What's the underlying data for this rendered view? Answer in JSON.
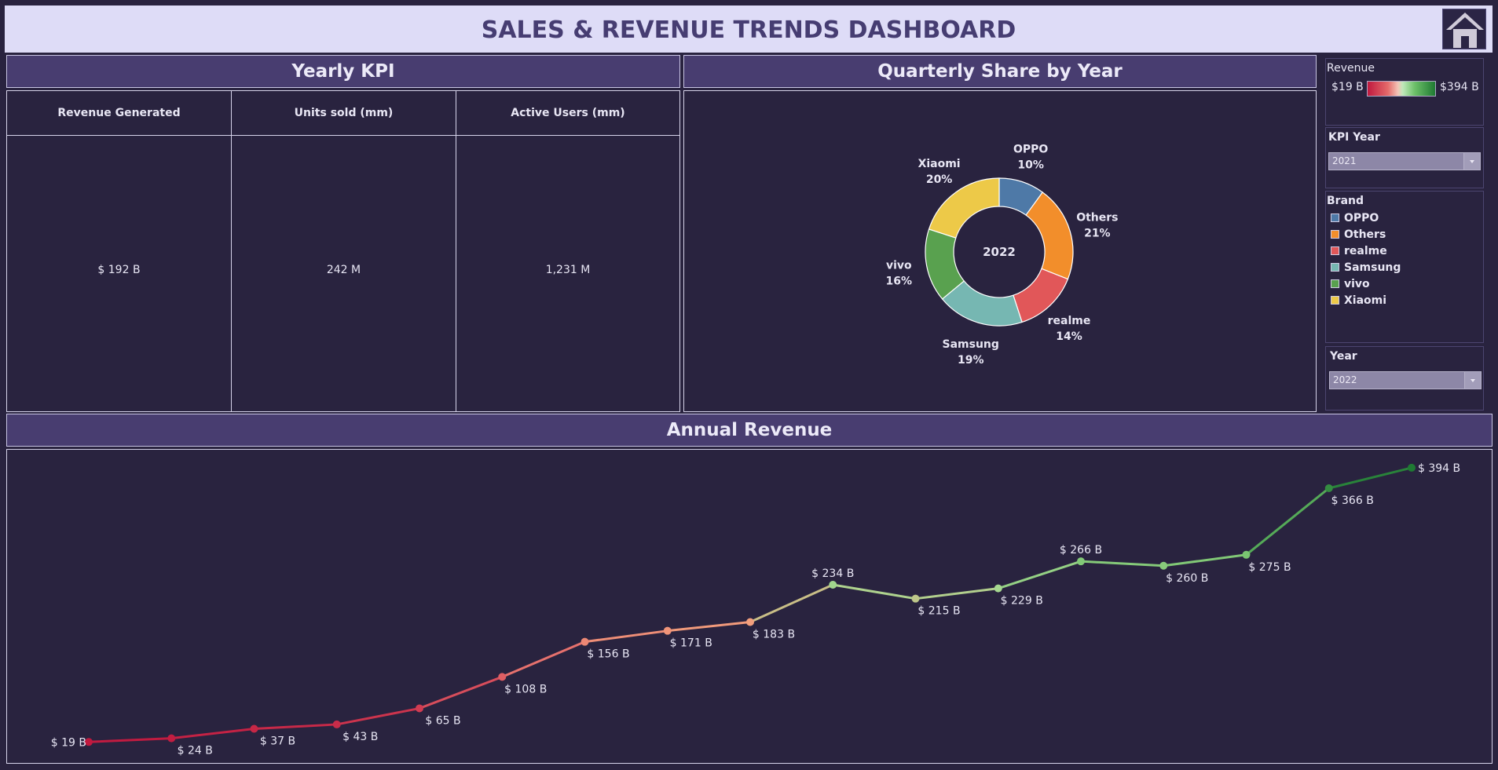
{
  "header": {
    "title": "SALES & REVENUE TRENDS DASHBOARD"
  },
  "kpi": {
    "section_title": "Yearly KPI",
    "columns": [
      {
        "label": "Revenue Generated",
        "value": "$ 192 B"
      },
      {
        "label": "Units sold (mm)",
        "value": "242 M"
      },
      {
        "label": "Active Users (mm)",
        "value": "1,231 M"
      }
    ]
  },
  "donut": {
    "section_title": "Quarterly Share by Year"
  },
  "revenue_section": {
    "section_title": "Annual Revenue"
  },
  "sidebar": {
    "revenue_legend": {
      "title": "Revenue",
      "min_label": "$19 B",
      "max_label": "$394 B"
    },
    "kpi_year": {
      "title": "KPI Year",
      "selected": "2021"
    },
    "brand_legend": {
      "title": "Brand"
    },
    "year_filter": {
      "title": "Year",
      "selected": "2022"
    }
  },
  "colors": {
    "OPPO": "#4e79a7",
    "Others": "#f28e2b",
    "realme": "#e15759",
    "Samsung": "#76b7b2",
    "vivo": "#59a14f",
    "Xiaomi": "#edc948"
  },
  "chart_data": [
    {
      "type": "pie",
      "center_label": "2022",
      "slices": [
        {
          "name": "OPPO",
          "pct": 10,
          "label": "10%"
        },
        {
          "name": "Others",
          "pct": 21,
          "label": "21%"
        },
        {
          "name": "realme",
          "pct": 14,
          "label": "14%"
        },
        {
          "name": "Samsung",
          "pct": 19,
          "label": "19%"
        },
        {
          "name": "vivo",
          "pct": 16,
          "label": "16%"
        },
        {
          "name": "Xiaomi",
          "pct": 20,
          "label": "20%"
        }
      ],
      "legend": [
        "OPPO",
        "Others",
        "realme",
        "Samsung",
        "vivo",
        "Xiaomi"
      ]
    },
    {
      "type": "line",
      "values": [
        19,
        24,
        37,
        43,
        65,
        108,
        156,
        171,
        183,
        234,
        215,
        229,
        266,
        260,
        275,
        366,
        394
      ],
      "labels": [
        "$ 19 B",
        "$ 24 B",
        "$ 37 B",
        "$ 43 B",
        "$ 65 B",
        "$ 108 B",
        "$ 156 B",
        "$ 171 B",
        "$ 183 B",
        "$ 234 B",
        "$ 215 B",
        "$ 229 B",
        "$ 266 B",
        "$ 260 B",
        "$ 275 B",
        "$ 366 B",
        "$ 394 B"
      ],
      "color_scale": {
        "min": 19,
        "max": 394
      },
      "ylim": [
        0,
        410
      ]
    }
  ]
}
